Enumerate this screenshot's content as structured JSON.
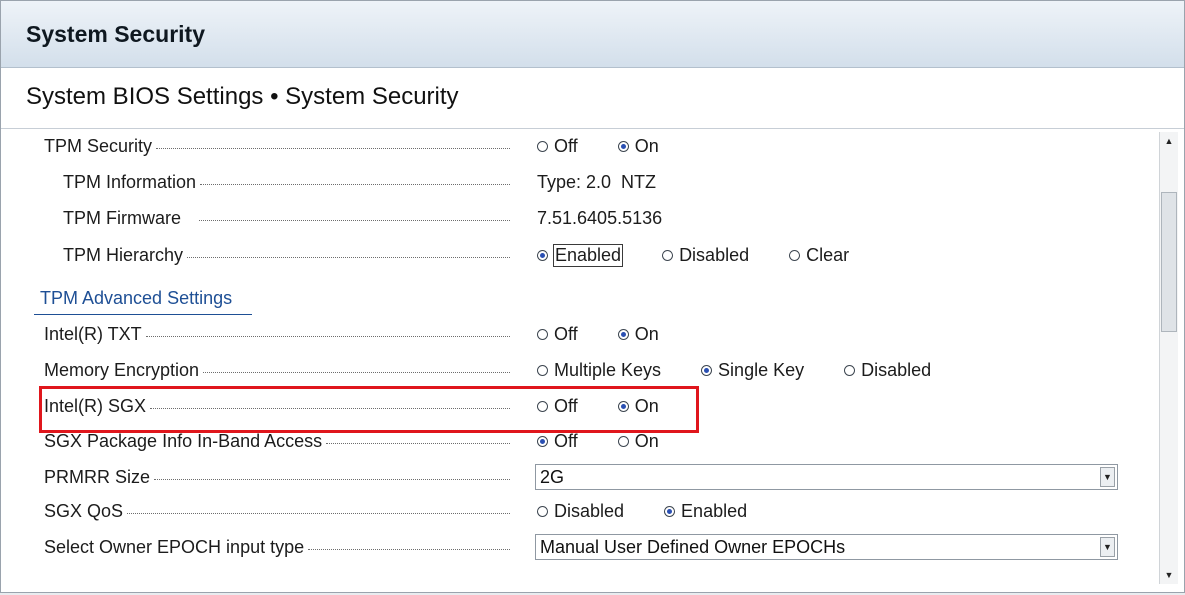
{
  "window": {
    "title": "System Security"
  },
  "breadcrumb": "System BIOS Settings • System Security",
  "rows": {
    "tpm_security": {
      "label": "TPM Security",
      "options": [
        "Off",
        "On"
      ],
      "selected": "On"
    },
    "tpm_information": {
      "label": "TPM Information",
      "value": "Type: 2.0  NTZ"
    },
    "tpm_firmware": {
      "label": "TPM Firmware",
      "value": "7.51.6405.5136"
    },
    "tpm_hierarchy": {
      "label": "TPM Hierarchy",
      "options": [
        "Enabled",
        "Disabled",
        "Clear"
      ],
      "selected": "Enabled"
    },
    "tpm_advanced_link": "TPM Advanced Settings",
    "intel_txt": {
      "label": "Intel(R) TXT",
      "options": [
        "Off",
        "On"
      ],
      "selected": "On"
    },
    "memory_encryption": {
      "label": "Memory Encryption",
      "options": [
        "Multiple Keys",
        "Single Key",
        "Disabled"
      ],
      "selected": "Single Key"
    },
    "intel_sgx": {
      "label": "Intel(R) SGX",
      "options": [
        "Off",
        "On"
      ],
      "selected": "On"
    },
    "sgx_package_info": {
      "label": "SGX Package Info In-Band Access",
      "options": [
        "Off",
        "On"
      ],
      "selected": "Off"
    },
    "prmrr_size": {
      "label": "PRMRR Size",
      "value": "2G"
    },
    "sgx_qos": {
      "label": "SGX QoS",
      "options": [
        "Disabled",
        "Enabled"
      ],
      "selected": "Enabled"
    },
    "owner_epoch": {
      "label": "Select Owner EPOCH input type",
      "value": "Manual User Defined Owner EPOCHs"
    }
  },
  "colors": {
    "highlight": "#e0161c",
    "link": "#1e4f95",
    "radio_selected": "#2a4fb2"
  }
}
